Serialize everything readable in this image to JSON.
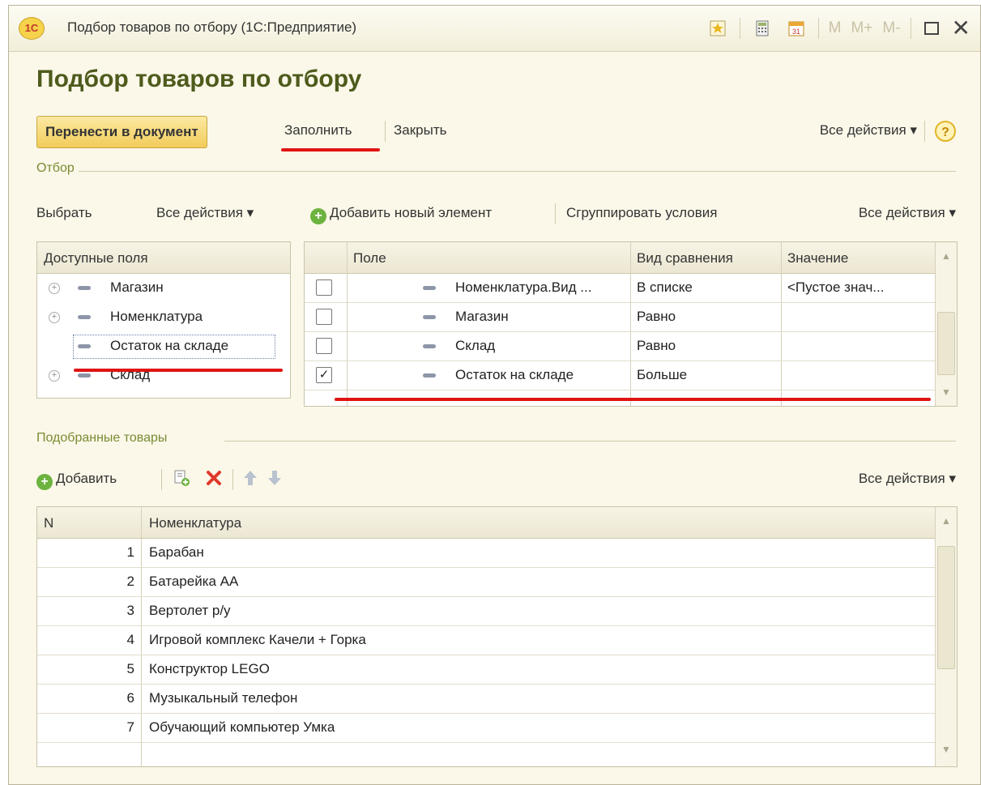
{
  "window": {
    "title": "Подбор товаров по отбору  (1С:Предприятие)",
    "logo": "1С",
    "toolbar_icons": [
      "favorites-icon",
      "calculator-icon",
      "calendar-icon"
    ],
    "m_labels": [
      "M",
      "M+",
      "M-"
    ],
    "maximize_icon": "maximize-icon",
    "close_glyph": "✕"
  },
  "page": {
    "title": "Подбор товаров по отбору"
  },
  "commands": {
    "transfer": "Перенести в документ",
    "fill": "Заполнить",
    "close": "Закрыть",
    "all_actions": "Все действия",
    "help": "?"
  },
  "filter": {
    "group_label": "Отбор",
    "select": "Выбрать",
    "all_actions_left": "Все действия",
    "add_new": "Добавить новый элемент",
    "group_conditions": "Сгруппировать условия",
    "all_actions_right": "Все действия",
    "available_fields_header": "Доступные поля",
    "available_fields": [
      {
        "label": "Магазин",
        "expandable": true
      },
      {
        "label": "Номенклатура",
        "expandable": true
      },
      {
        "label": "Остаток на складе",
        "expandable": false,
        "selected": true
      },
      {
        "label": "Склад",
        "expandable": true
      }
    ],
    "columns": {
      "field": "Поле",
      "comparison": "Вид сравнения",
      "value": "Значение"
    },
    "rows": [
      {
        "checked": false,
        "field": "Номенклатура.Вид ...",
        "comparison": "В списке",
        "value": "<Пустое знач..."
      },
      {
        "checked": false,
        "field": "Магазин",
        "comparison": "Равно",
        "value": ""
      },
      {
        "checked": false,
        "field": "Склад",
        "comparison": "Равно",
        "value": ""
      },
      {
        "checked": true,
        "field": "Остаток на складе",
        "comparison": "Больше",
        "value": ""
      }
    ]
  },
  "goods": {
    "group_label": "Подобранные товары",
    "add": "Добавить",
    "all_actions": "Все действия",
    "columns": {
      "n": "N",
      "name": "Номенклатура"
    },
    "rows": [
      {
        "n": "1",
        "name": "Барабан"
      },
      {
        "n": "2",
        "name": "Батарейка АА"
      },
      {
        "n": "3",
        "name": "Вертолет р/у"
      },
      {
        "n": "4",
        "name": "Игровой комплекс Качели + Горка"
      },
      {
        "n": "5",
        "name": "Конструктор LEGO"
      },
      {
        "n": "6",
        "name": "Музыкальный телефон"
      },
      {
        "n": "7",
        "name": "Обучающий компьютер Умка"
      }
    ]
  },
  "colors": {
    "accent_red": "#e01414",
    "title_green": "#4e5b1c",
    "button_yellow": "#f2cc5a"
  }
}
